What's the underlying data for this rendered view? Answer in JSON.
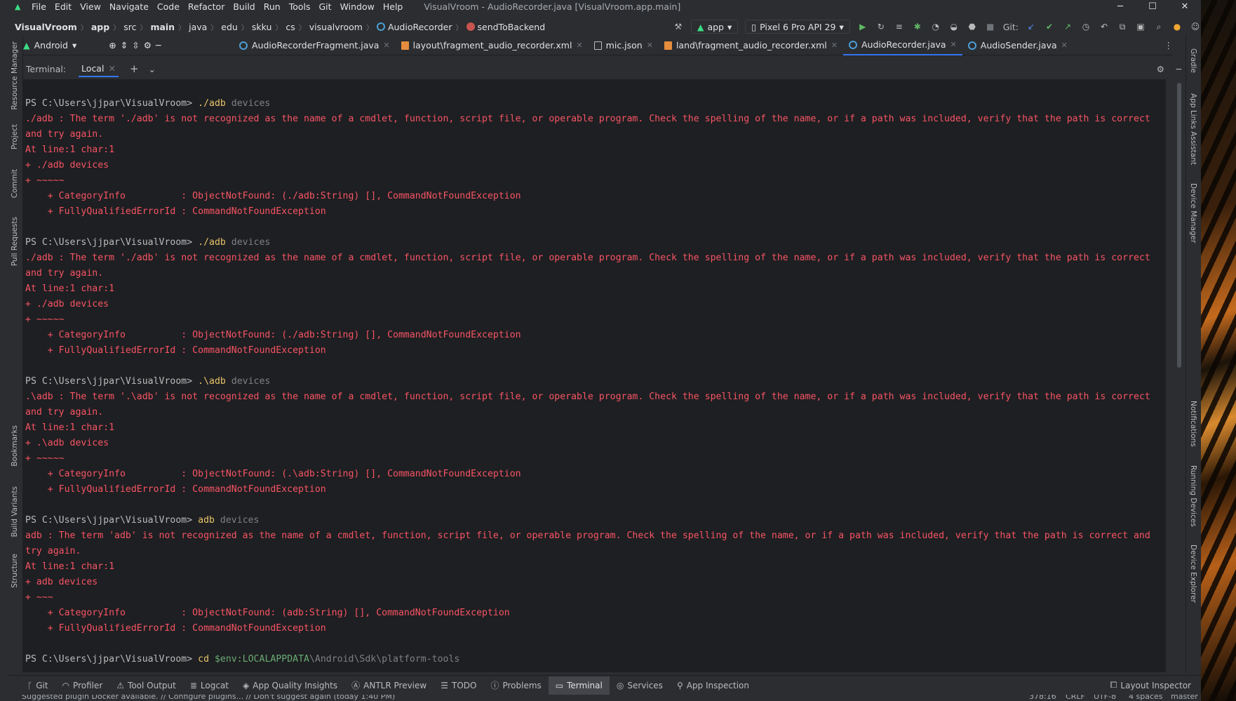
{
  "window": {
    "title": "VisualVroom - AudioRecorder.java [VisualVroom.app.main]",
    "menu": [
      "File",
      "Edit",
      "View",
      "Navigate",
      "Code",
      "Refactor",
      "Build",
      "Run",
      "Tools",
      "Git",
      "Window",
      "Help"
    ]
  },
  "breadcrumbs": [
    "VisualVroom",
    "app",
    "src",
    "main",
    "java",
    "edu",
    "skku",
    "cs",
    "visualvroom",
    "AudioRecorder",
    "sendToBackend"
  ],
  "toolbar": {
    "run_config": "app",
    "device": "Pixel 6 Pro API 29",
    "git_label": "Git:"
  },
  "project_view": "Android",
  "editor_tabs": [
    {
      "label": "AudioRecorderFragment.java",
      "type": "java"
    },
    {
      "label": "layout\\fragment_audio_recorder.xml",
      "type": "xml"
    },
    {
      "label": "mic.json",
      "type": "json"
    },
    {
      "label": "land\\fragment_audio_recorder.xml",
      "type": "xml"
    },
    {
      "label": "AudioRecorder.java",
      "type": "java",
      "active": true
    },
    {
      "label": "AudioSender.java",
      "type": "java"
    }
  ],
  "left_tools": [
    "Resource Manager",
    "Project",
    "Commit",
    "Pull Requests",
    "Bookmarks",
    "Build Variants",
    "Structure"
  ],
  "right_tools": [
    "Gradle",
    "App Links Assistant",
    "Device Manager",
    "Notifications",
    "Running Devices",
    "Device Explorer"
  ],
  "terminal": {
    "label": "Terminal:",
    "tab": "Local",
    "blocks": [
      {
        "prompt": "PS C:\\Users\\jjpar\\VisualVroom> ",
        "cmd": "./adb",
        "arg": "devices",
        "errors": [
          "./adb : The term './adb' is not recognized as the name of a cmdlet, function, script file, or operable program. Check the spelling of the name, or if a path was included, verify that the path is correct",
          "and try again.",
          "At line:1 char:1",
          "+ ./adb devices",
          "+ ~~~~~",
          "    + CategoryInfo          : ObjectNotFound: (./adb:String) [], CommandNotFoundException",
          "    + FullyQualifiedErrorId : CommandNotFoundException"
        ]
      },
      {
        "prompt": "PS C:\\Users\\jjpar\\VisualVroom> ",
        "cmd": "./adb",
        "arg": "devices",
        "errors": [
          "./adb : The term './adb' is not recognized as the name of a cmdlet, function, script file, or operable program. Check the spelling of the name, or if a path was included, verify that the path is correct",
          "and try again.",
          "At line:1 char:1",
          "+ ./adb devices",
          "+ ~~~~~",
          "    + CategoryInfo          : ObjectNotFound: (./adb:String) [], CommandNotFoundException",
          "    + FullyQualifiedErrorId : CommandNotFoundException"
        ]
      },
      {
        "prompt": "PS C:\\Users\\jjpar\\VisualVroom> ",
        "cmd": ".\\adb",
        "arg": "devices",
        "errors": [
          ".\\adb : The term '.\\adb' is not recognized as the name of a cmdlet, function, script file, or operable program. Check the spelling of the name, or if a path was included, verify that the path is correct",
          "and try again.",
          "At line:1 char:1",
          "+ .\\adb devices",
          "+ ~~~~~",
          "    + CategoryInfo          : ObjectNotFound: (.\\adb:String) [], CommandNotFoundException",
          "    + FullyQualifiedErrorId : CommandNotFoundException"
        ]
      },
      {
        "prompt": "PS C:\\Users\\jjpar\\VisualVroom> ",
        "cmd": "adb",
        "arg": "devices",
        "errors": [
          "adb : The term 'adb' is not recognized as the name of a cmdlet, function, script file, or operable program. Check the spelling of the name, or if a path was included, verify that the path is correct and",
          "try again.",
          "At line:1 char:1",
          "+ adb devices",
          "+ ~~~",
          "    + CategoryInfo          : ObjectNotFound: (adb:String) [], CommandNotFoundException",
          "    + FullyQualifiedErrorId : CommandNotFoundException"
        ]
      }
    ],
    "current_prompt": "PS C:\\Users\\jjpar\\VisualVroom> ",
    "current_cmd": "cd",
    "current_var": "$env:LOCALAPPDATA",
    "current_arg": "\\Android\\Sdk\\platform-tools"
  },
  "bottom_tools": [
    {
      "label": "Git",
      "icon": "git-branch-icon"
    },
    {
      "label": "Profiler",
      "icon": "profiler-icon"
    },
    {
      "label": "Tool Output",
      "icon": "tool-output-icon"
    },
    {
      "label": "Logcat",
      "icon": "logcat-icon"
    },
    {
      "label": "App Quality Insights",
      "icon": "insights-icon"
    },
    {
      "label": "ANTLR Preview",
      "icon": "antlr-icon"
    },
    {
      "label": "TODO",
      "icon": "todo-icon"
    },
    {
      "label": "Problems",
      "icon": "problems-icon"
    },
    {
      "label": "Terminal",
      "icon": "terminal-icon",
      "active": true
    },
    {
      "label": "Services",
      "icon": "services-icon"
    },
    {
      "label": "App Inspection",
      "icon": "inspection-icon"
    }
  ],
  "layout_inspector": "Layout Inspector",
  "status": {
    "message": "Suggested plugin Docker available. // Configure plugins... // Don't suggest again (today 1:40 PM)",
    "position": "378:16",
    "line_sep": "CRLF",
    "encoding": "UTF-8",
    "indent": "4 spaces",
    "branch": "master"
  }
}
